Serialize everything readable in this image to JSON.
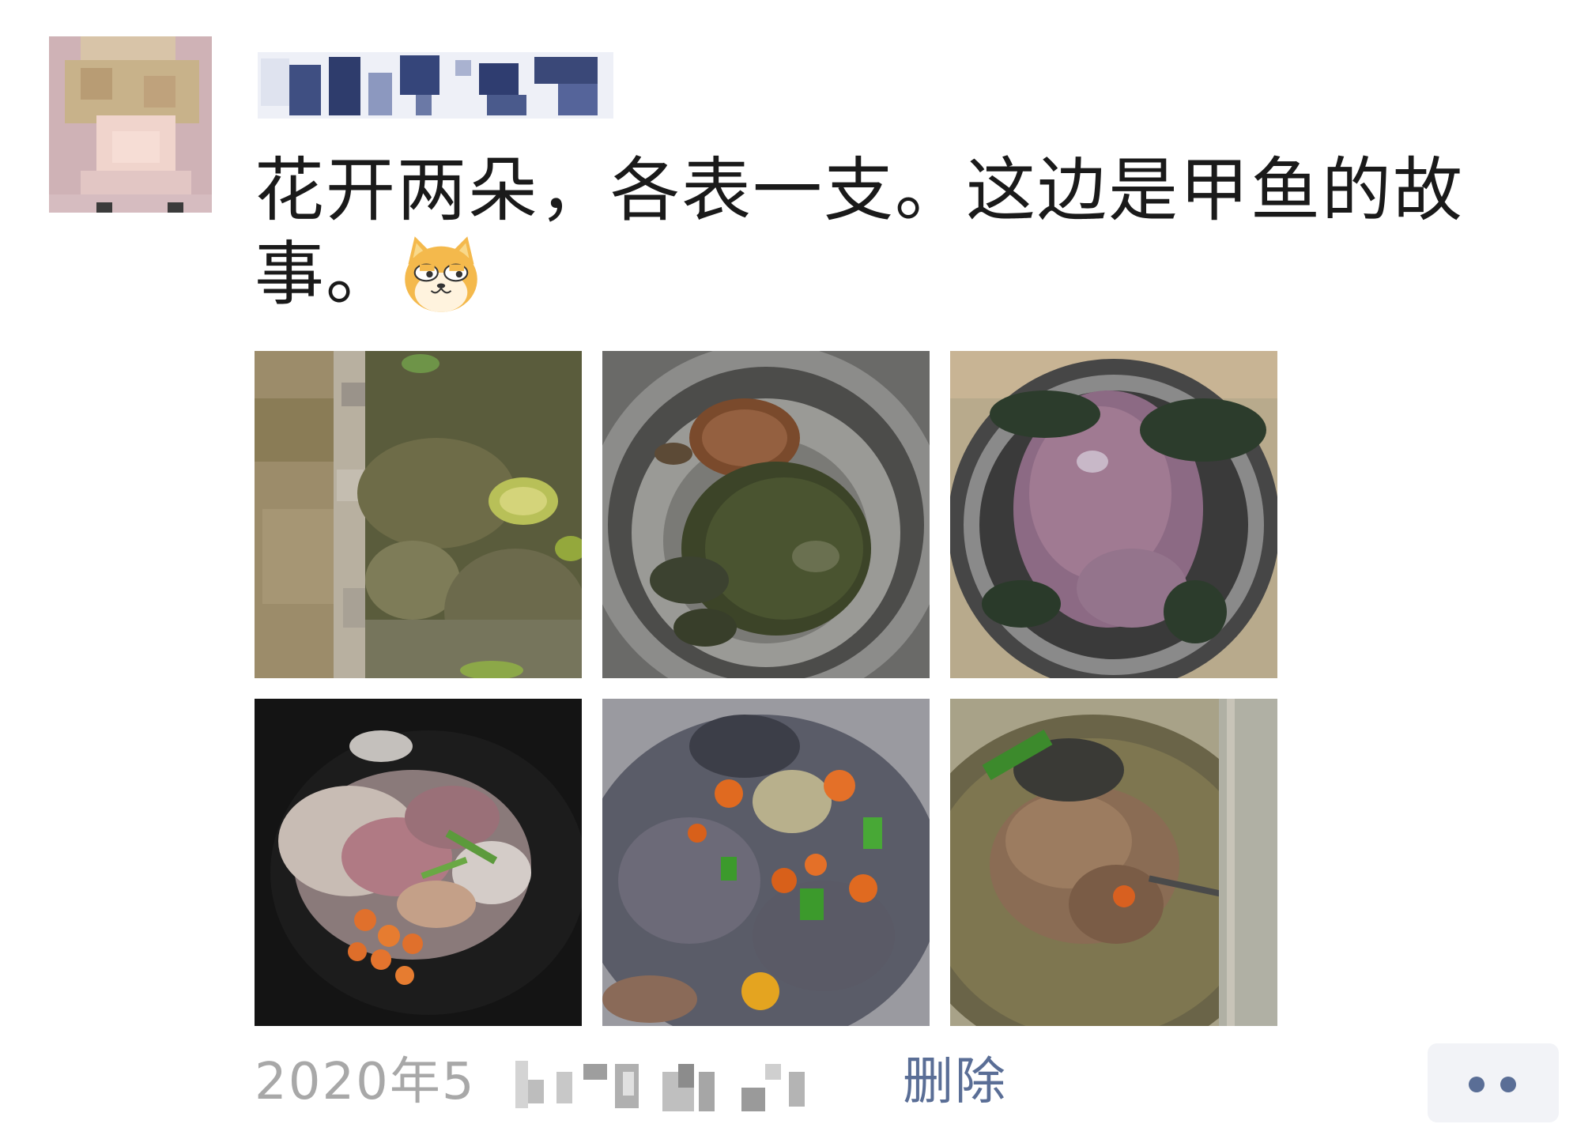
{
  "post": {
    "text": "花开两朵，各表一支。这边是甲鱼的故事。",
    "emoji": "doge-cat-emoji"
  },
  "photos": [
    {
      "label": "pond with rocks and lily pads"
    },
    {
      "label": "two turtles in steel basin"
    },
    {
      "label": "butchered soft-shell turtle in basin"
    },
    {
      "label": "raw turtle pieces with goji in pot"
    },
    {
      "label": "cooked turtle with peppers"
    },
    {
      "label": "turtle soup in bowl"
    }
  ],
  "footer": {
    "timestamp_visible": "2020年5",
    "delete_label": "删除"
  },
  "colors": {
    "link": "#5a6e96",
    "timestamp": "#a8a8a8",
    "more_button_bg": "#f2f3f7"
  }
}
